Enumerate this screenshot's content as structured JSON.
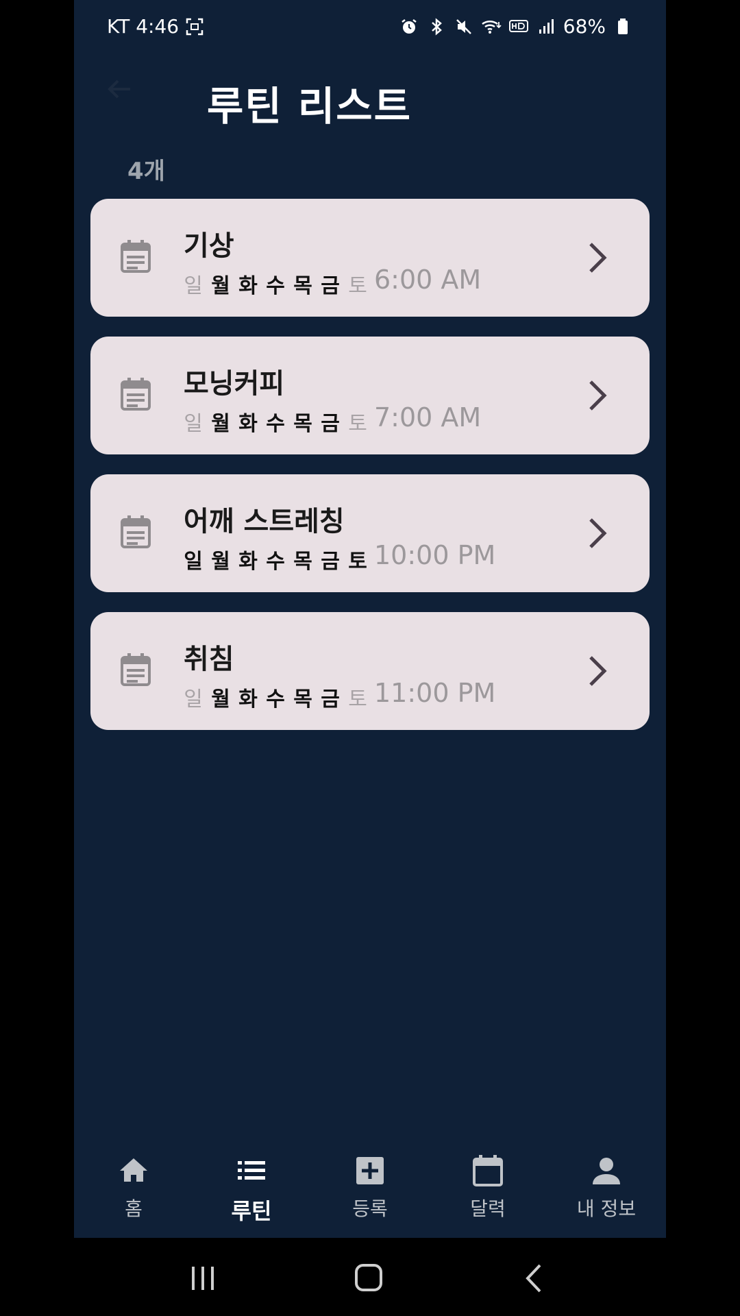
{
  "status_bar": {
    "carrier_time": "KT 4:46",
    "battery": "68%",
    "icons": [
      "screenshot-icon",
      "alarm-icon",
      "bluetooth-icon",
      "mute-icon",
      "wifi-icon",
      "hd-icon",
      "signal-icon",
      "battery-icon"
    ]
  },
  "header": {
    "title": "루틴 리스트",
    "back_icon": "back-arrow-icon"
  },
  "summary": {
    "count": "4개"
  },
  "weekday_labels": [
    "일",
    "월",
    "화",
    "수",
    "목",
    "금",
    "토"
  ],
  "routines": [
    {
      "name": "기상",
      "time": "6:00 AM",
      "active_days": [
        false,
        true,
        true,
        true,
        true,
        true,
        false
      ]
    },
    {
      "name": "모닝커피",
      "time": "7:00 AM",
      "active_days": [
        false,
        true,
        true,
        true,
        true,
        true,
        false
      ]
    },
    {
      "name": "어깨 스트레칭",
      "time": "10:00 PM",
      "active_days": [
        true,
        true,
        true,
        true,
        true,
        true,
        true
      ]
    },
    {
      "name": "취침",
      "time": "11:00 PM",
      "active_days": [
        false,
        true,
        true,
        true,
        true,
        true,
        false
      ]
    }
  ],
  "bottom_nav": {
    "items": [
      {
        "label": "홈",
        "icon": "home-icon",
        "active": false
      },
      {
        "label": "루틴",
        "icon": "list-icon",
        "active": true
      },
      {
        "label": "등록",
        "icon": "add-box-icon",
        "active": false
      },
      {
        "label": "달력",
        "icon": "calendar-icon",
        "active": false
      },
      {
        "label": "내 정보",
        "icon": "person-icon",
        "active": false
      }
    ]
  },
  "colors": {
    "background": "#0f2037",
    "card": "#e9e0e4",
    "active_day": "#111111",
    "inactive_day": "#a8a3a6",
    "time_text": "#9c989b"
  }
}
